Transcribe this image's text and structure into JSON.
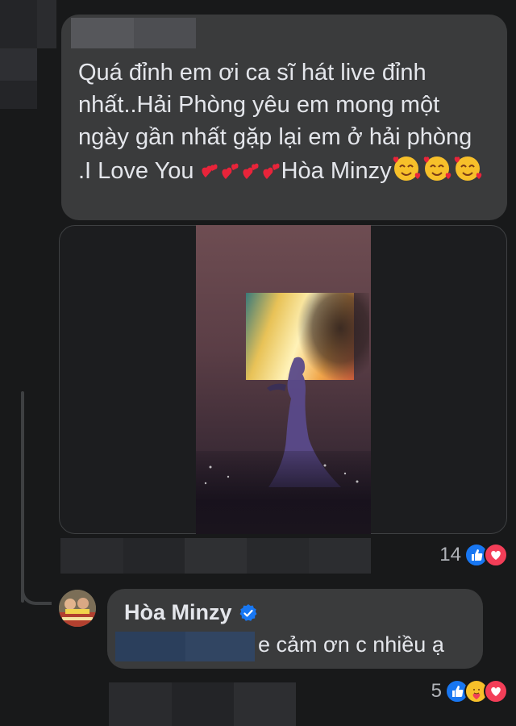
{
  "comment": {
    "text": "Quá đỉnh em ơi ca sĩ hát live đỉnh nhất..Hải Phòng yêu em mong một ngày gần nhất gặp lại em ở hải phòng .I Love You",
    "trailing_name": "Hòa Minzy",
    "hearts_icon": "two-hearts-emoji",
    "love_face_icon": "smiling-face-with-hearts-emoji",
    "reaction_count": "14",
    "reactions": [
      "like-icon",
      "love-icon"
    ]
  },
  "reply": {
    "author": "Hòa Minzy",
    "verified_icon": "verified-badge-icon",
    "text": "e cảm ơn c nhiều ạ",
    "reaction_count": "5",
    "reactions": [
      "like-icon",
      "care-icon",
      "love-icon"
    ]
  },
  "colors": {
    "background": "#18191a",
    "bubble": "#3a3b3c",
    "text": "#e4e6eb",
    "secondary_text": "#b0b3b8",
    "like_blue": "#1877f2",
    "love_red": "#f33e58"
  }
}
